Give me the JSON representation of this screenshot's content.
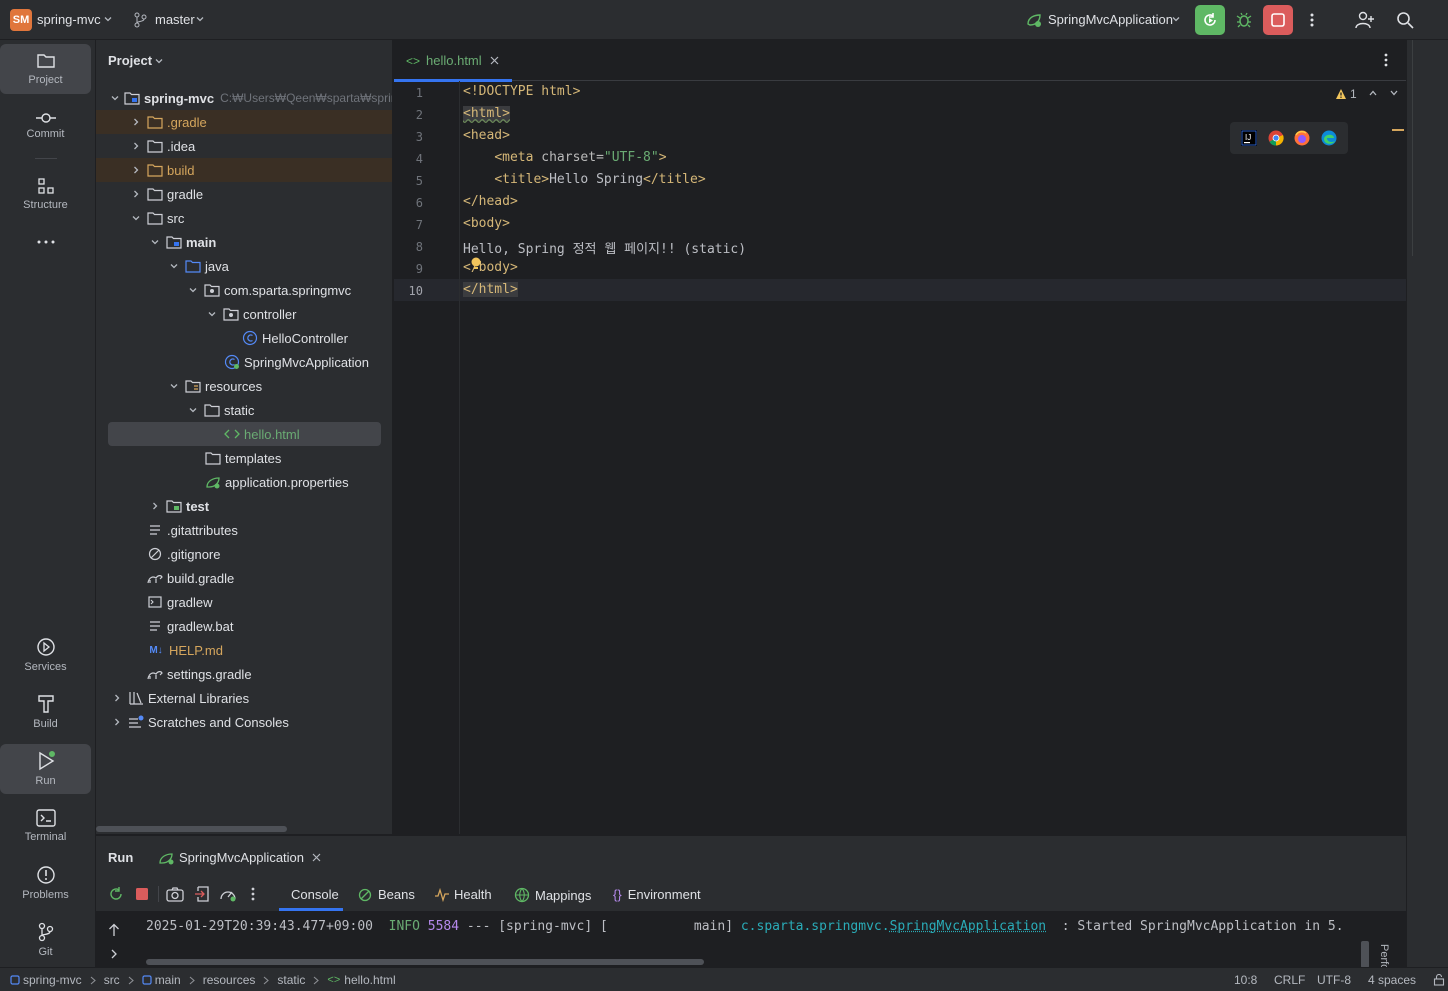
{
  "titlebar": {
    "project_badge": "SM",
    "project_name": "spring-mvc",
    "branch": "master",
    "run_config": "SpringMvcApplication"
  },
  "left_tools": [
    {
      "label": "Project",
      "icon": "folder-icon"
    },
    {
      "label": "Commit",
      "icon": "commit-icon"
    },
    {
      "label": "Structure",
      "icon": "structure-icon"
    },
    {
      "label": "Services",
      "icon": "services-icon"
    },
    {
      "label": "Build",
      "icon": "build-icon"
    },
    {
      "label": "Run",
      "icon": "run-icon"
    },
    {
      "label": "Terminal",
      "icon": "terminal-icon"
    },
    {
      "label": "Problems",
      "icon": "problems-icon"
    },
    {
      "label": "Git",
      "icon": "git-icon"
    }
  ],
  "project_panel": {
    "title": "Project",
    "root": {
      "name": "spring-mvc",
      "path": "C:₩Users₩Qeen₩sparta₩springp"
    },
    "items": [
      {
        "name": ".gradle",
        "icon": "folder-icon"
      },
      {
        "name": ".idea",
        "icon": "folder-icon"
      },
      {
        "name": "build",
        "icon": "folder-icon"
      },
      {
        "name": "gradle",
        "icon": "folder-icon"
      },
      {
        "name": "src",
        "icon": "folder-icon"
      },
      {
        "name": "main",
        "icon": "module-folder-icon"
      },
      {
        "name": "java",
        "icon": "source-folder-icon"
      },
      {
        "name": "com.sparta.springmvc",
        "icon": "package-icon"
      },
      {
        "name": "controller",
        "icon": "package-icon"
      },
      {
        "name": "HelloController",
        "icon": "class-icon"
      },
      {
        "name": "SpringMvcApplication",
        "icon": "spring-class-icon"
      },
      {
        "name": "resources",
        "icon": "resources-folder-icon"
      },
      {
        "name": "static",
        "icon": "folder-icon"
      },
      {
        "name": "hello.html",
        "icon": "html-file-icon"
      },
      {
        "name": "templates",
        "icon": "folder-icon"
      },
      {
        "name": "application.properties",
        "icon": "spring-properties-icon"
      },
      {
        "name": "test",
        "icon": "test-folder-icon"
      },
      {
        "name": ".gitattributes",
        "icon": "text-file-icon"
      },
      {
        "name": ".gitignore",
        "icon": "ignore-file-icon"
      },
      {
        "name": "build.gradle",
        "icon": "gradle-file-icon"
      },
      {
        "name": "gradlew",
        "icon": "shell-file-icon"
      },
      {
        "name": "gradlew.bat",
        "icon": "text-file-icon"
      },
      {
        "name": "HELP.md",
        "icon": "markdown-file-icon",
        "badge": "M↓"
      },
      {
        "name": "settings.gradle",
        "icon": "gradle-file-icon"
      },
      {
        "name": "External Libraries",
        "icon": "libraries-icon"
      },
      {
        "name": "Scratches and Consoles",
        "icon": "scratches-icon"
      }
    ]
  },
  "editor": {
    "tab": {
      "title": "hello.html",
      "icon_text": "<>"
    },
    "warnings": "1",
    "current_line": 10,
    "lines": [
      "1",
      "2",
      "3",
      "4",
      "5",
      "6",
      "7",
      "8",
      "9",
      "10"
    ],
    "code": {
      "l1": "<!DOCTYPE html>",
      "l2": "<html>",
      "l3": "<head>",
      "l4_tag_open": "<meta ",
      "l4_attr": "charset",
      "l4_eq": "=",
      "l4_val": "\"UTF-8\"",
      "l4_close": ">",
      "l5_open": "<title>",
      "l5_text": "Hello Spring",
      "l5_close": "</title>",
      "l6": "</head>",
      "l7": "<body>",
      "l8": "Hello, Spring 정적 웹 페이지!! (static)",
      "l9": "</body>",
      "l10": "</html>"
    },
    "browsers": [
      "intellij-icon",
      "chrome-icon",
      "firefox-icon",
      "edge-icon"
    ]
  },
  "run_panel": {
    "title": "Run",
    "tab": "SpringMvcApplication",
    "subtabs": [
      "Console",
      "Beans",
      "Health",
      "Mappings",
      "Environment"
    ],
    "log": {
      "timestamp": "2025-01-29T20:39:43.477+09:00",
      "level": "INFO",
      "pid": "5584",
      "sep": " --- [spring-mvc] [           main] ",
      "logger_prefix": "c.sparta.springmvc.",
      "logger_class": "SpringMvcApplication",
      "message": "  : Started SpringMvcApplication in 5."
    },
    "side_label": "Perfo"
  },
  "statusbar": {
    "breadcrumb": [
      "spring-mvc",
      "src",
      "main",
      "resources",
      "static",
      "hello.html"
    ],
    "position": "10:8",
    "line_sep": "CRLF",
    "encoding": "UTF-8",
    "indent": "4 spaces"
  },
  "colors": {
    "accent": "#3574f0",
    "run_green": "#5fb865",
    "stop_red": "#db5c5c",
    "folder_excluded": "#d5a65d"
  }
}
